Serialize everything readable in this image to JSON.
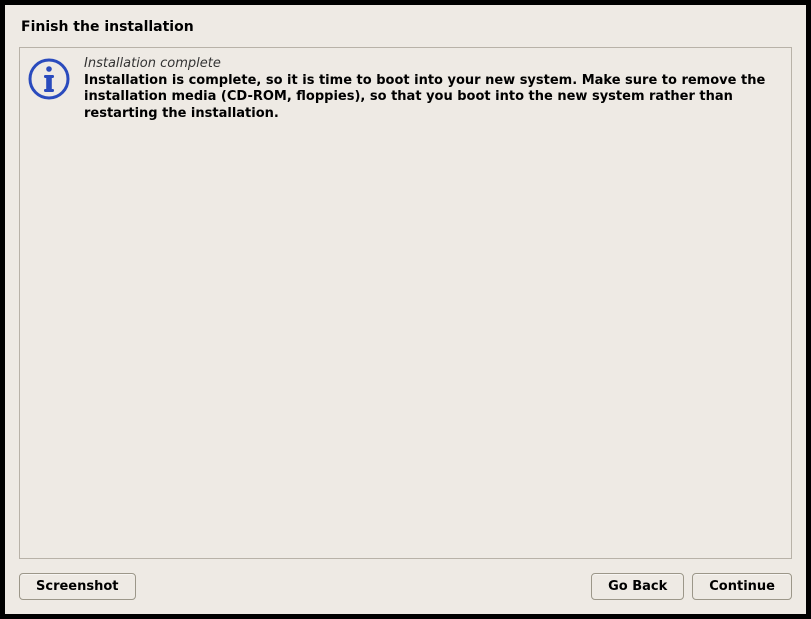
{
  "header": {
    "title": "Finish the installation"
  },
  "info": {
    "subtitle": "Installation complete",
    "body": "Installation is complete, so it is time to boot into your new system. Make sure to remove the installation media (CD-ROM, floppies), so that you boot into the new system rather than restarting the installation."
  },
  "buttons": {
    "screenshot": "Screenshot",
    "go_back": "Go Back",
    "continue": "Continue"
  }
}
